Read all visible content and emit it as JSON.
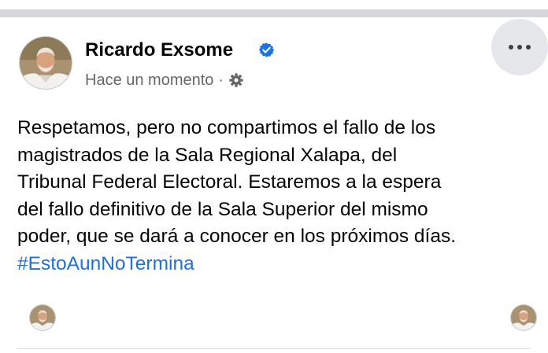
{
  "post": {
    "author": {
      "name": "Ricardo Exsome",
      "verified": true
    },
    "meta": {
      "timestamp": "Hace un momento",
      "separator": "·",
      "audience_icon": "gear-icon"
    },
    "more_icon": "more-options-icon",
    "body_lines": [
      "Respetamos, pero no compartimos el fallo de los",
      "magistrados de la Sala Regional Xalapa, del",
      "Tribunal Federal Electoral. Estaremos a la espera",
      "del fallo definitivo de la Sala Superior del mismo",
      "poder, que se dará a conocer en los próximos días."
    ],
    "hashtag": "#EstoAunNoTermina"
  },
  "colors": {
    "name_text": "#050505",
    "meta_text": "#65676b",
    "hashtag": "#216fdb",
    "verified_badge": "#1b74e4",
    "more_button_bg": "#e6e7eb",
    "divider": "#d4d6d9"
  }
}
